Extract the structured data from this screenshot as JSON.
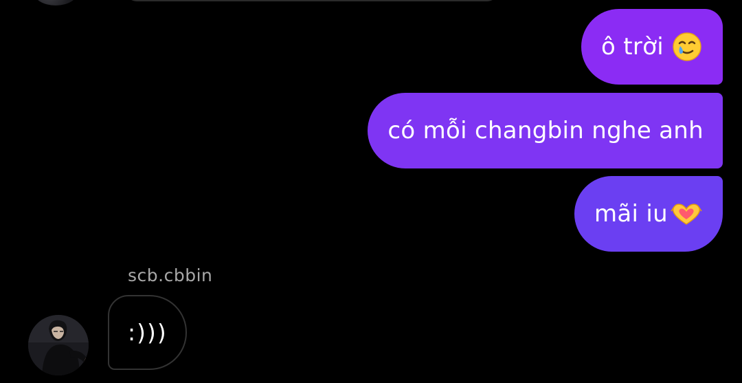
{
  "conversation": {
    "outgoing": [
      {
        "text": "ô trời",
        "emoji": "smiling-face-with-tear-emoji"
      },
      {
        "text": "có mỗi changbin nghe anh"
      },
      {
        "text": "mãi iu",
        "emoji": "heart-hands-emoji"
      }
    ],
    "incoming": {
      "sender": "scb.cbbin",
      "text": ":)))"
    }
  },
  "colors": {
    "background": "#000000",
    "bubble_out_top": "#8b2cf4",
    "bubble_out_mid": "#7f35f3",
    "bubble_out_bottom": "#6b3ff2",
    "bubble_in_border": "#333333",
    "sender_name": "#a8a8a8"
  }
}
